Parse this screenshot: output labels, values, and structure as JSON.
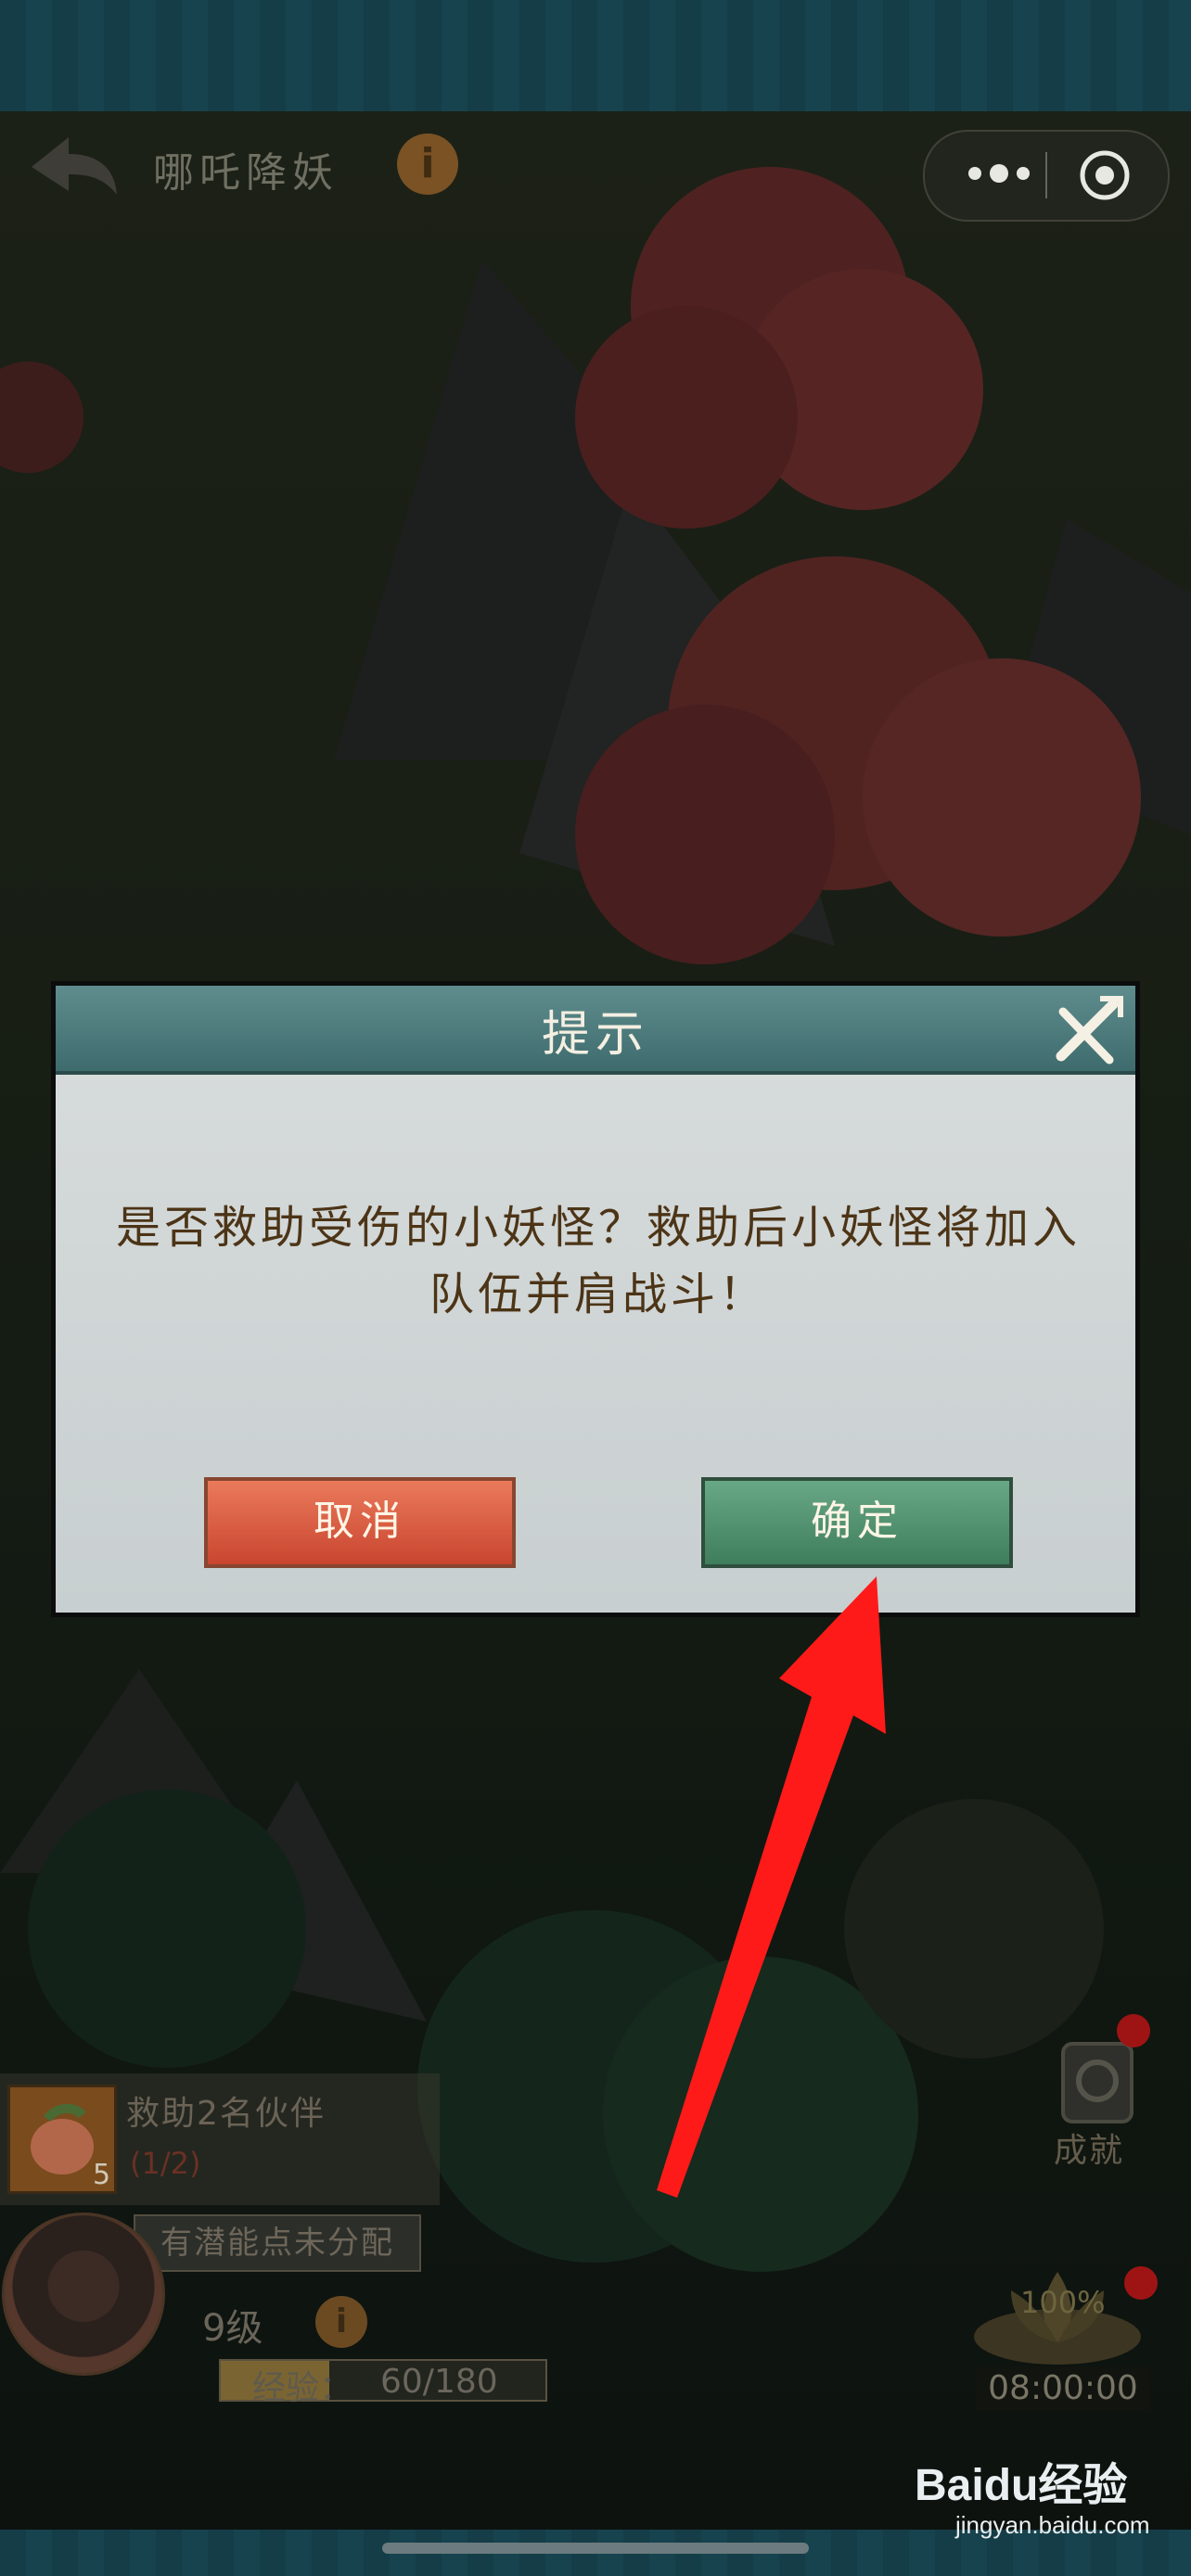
{
  "header": {
    "title": "哪吒降妖",
    "info_glyph": "i"
  },
  "dialog": {
    "title": "提示",
    "message": "是否救助受伤的小妖怪？救助后小妖怪将加入队伍并肩战斗！",
    "cancel_label": "取消",
    "confirm_label": "确定"
  },
  "quest": {
    "title": "救助2名伙伴",
    "progress": "(1/2)",
    "item_count": "5"
  },
  "player": {
    "potential_notice": "有潜能点未分配",
    "level": "9级",
    "exp_label": "经验：",
    "exp_value": "60/180",
    "exp_current": 60,
    "exp_max": 180
  },
  "achievement": {
    "label": "成就"
  },
  "lotus": {
    "percent": "100%",
    "timer": "08:00:00"
  },
  "watermark": {
    "logo": "Baidu经验",
    "url": "jingyan.baidu.com"
  },
  "colors": {
    "cancel": "#d9583f",
    "confirm": "#52926f",
    "header": "#4e7d7e",
    "arrow": "#ff1a1a"
  },
  "icons": [
    "back-arrow-icon",
    "info-icon",
    "more-dots-icon",
    "target-icon",
    "close-icon",
    "scroll-icon",
    "lotus-icon",
    "peach-icon"
  ]
}
